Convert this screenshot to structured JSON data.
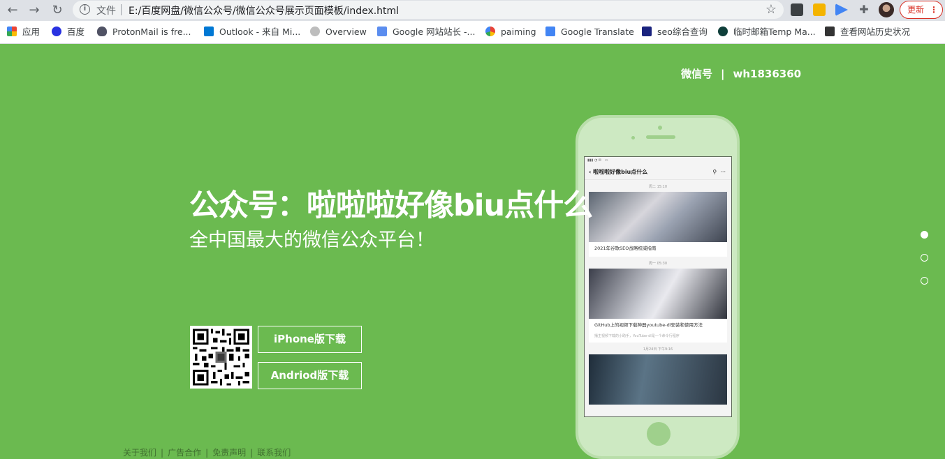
{
  "browser": {
    "scheme_label": "文件",
    "url": "E:/百度网盘/微信公众号/微信公众号展示页面模板/index.html",
    "update_label": "更新",
    "bookmarks": [
      "应用",
      "百度",
      "ProtonMail is fre...",
      "Outlook - 来自 Mi...",
      "Overview",
      "Google 网站站长 -...",
      "paiming",
      "Google Translate",
      "seo综合查询",
      "临时邮箱Temp Ma...",
      "查看网站历史状况"
    ]
  },
  "header": {
    "wechat_label": "微信号",
    "divider": "|",
    "wechat_id": "wh1836360"
  },
  "hero": {
    "title": "公众号：啦啦啦好像biu点什么",
    "subtitle": "全中国最大的微信公众平台！"
  },
  "downloads": {
    "iphone": "iPhone版下载",
    "android": "Andriod版下载"
  },
  "footer": {
    "links": [
      "关于我们",
      "广告合作",
      "免责声明",
      "联系我们"
    ],
    "separator": "|"
  },
  "phone_screen": {
    "title": "啦啦啦好像biu点什么",
    "articles": [
      {
        "date": "周二 15:10",
        "caption": "2021年谷歌SEO战略权威指南",
        "meta": ""
      },
      {
        "date": "周一 05:30",
        "caption": "GitHub上的视频下载神器youtube-dl安装和使用方法",
        "meta": "播主视频下载的小助手，YouTube-dl是一个命令行程序"
      },
      {
        "date": "1月24日 下午9:16",
        "caption": "",
        "meta": ""
      }
    ]
  },
  "colors": {
    "page_background": "#6bba50",
    "phone_body": "#cde9c2",
    "text": "#ffffff"
  },
  "pagination": {
    "count": 3,
    "active_index": 0
  }
}
